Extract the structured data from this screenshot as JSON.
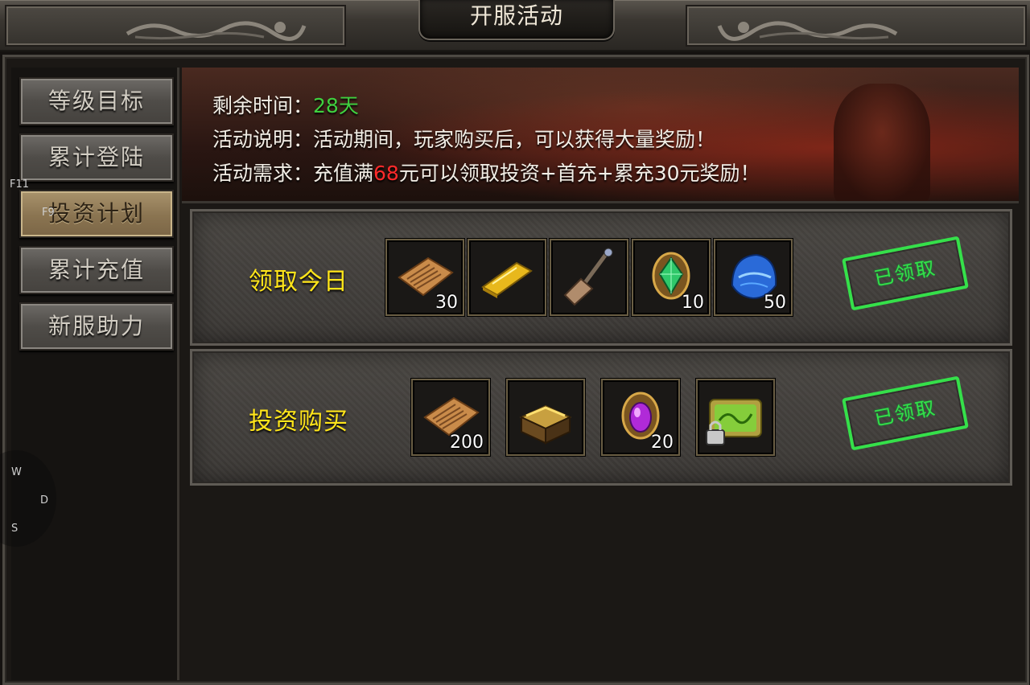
{
  "window": {
    "title": "开服活动"
  },
  "sidebar": {
    "items": [
      {
        "label": "等级目标",
        "active": false
      },
      {
        "label": "累计登陆",
        "active": false
      },
      {
        "label": "投资计划",
        "active": true
      },
      {
        "label": "累计充值",
        "active": false
      },
      {
        "label": "新服助力",
        "active": false
      }
    ]
  },
  "hotkeys": {
    "f11": "F11",
    "f9": "F9",
    "w": "W",
    "d": "D",
    "s": "S"
  },
  "banner": {
    "time_label": "剩余时间：",
    "time_value": "28天",
    "desc_label": "活动说明：",
    "desc_text": "活动期间，玩家购买后，可以获得大量奖励！",
    "req_label": "活动需求：",
    "req_prefix": "充值满",
    "req_amount": "68",
    "req_suffix": "元可以领取投资+首充+累充30元奖励！"
  },
  "rows": [
    {
      "label": "领取今日",
      "status": "已领取",
      "items": [
        {
          "icon": "scroll-icon",
          "count": "30"
        },
        {
          "icon": "gold-bar-icon",
          "count": ""
        },
        {
          "icon": "shovel-icon",
          "count": ""
        },
        {
          "icon": "green-gem-icon",
          "count": "10"
        },
        {
          "icon": "blue-helmet-icon",
          "count": "50"
        }
      ]
    },
    {
      "label": "投资购买",
      "status": "已领取",
      "items": [
        {
          "icon": "scroll-icon",
          "count": "200"
        },
        {
          "icon": "treasure-chest-icon",
          "count": ""
        },
        {
          "icon": "purple-gem-icon",
          "count": "20"
        },
        {
          "icon": "locked-green-card-icon",
          "count": ""
        }
      ]
    }
  ],
  "colors": {
    "accent_yellow": "#ffe51a",
    "stamp_green": "#35e04a",
    "time_green": "#3fd03f",
    "amount_red": "#ff2a2a"
  }
}
